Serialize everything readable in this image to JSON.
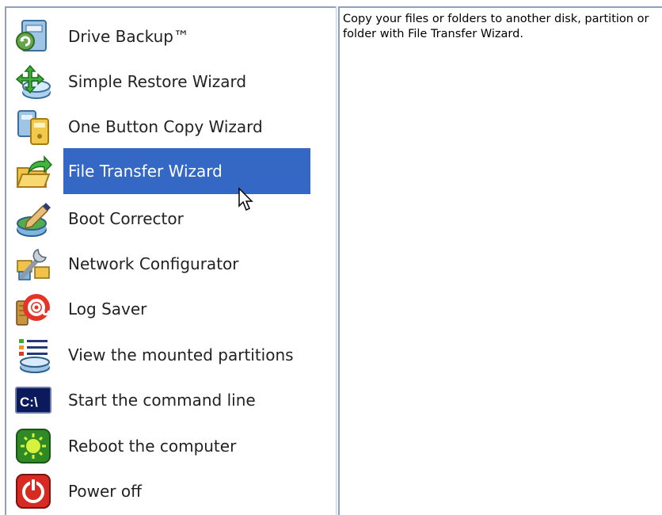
{
  "menu": {
    "items": [
      {
        "label": "Drive Backup™",
        "icon": "drive-backup-icon"
      },
      {
        "label": "Simple Restore Wizard",
        "icon": "restore-icon"
      },
      {
        "label": "One Button Copy Wizard",
        "icon": "copy-disk-icon"
      },
      {
        "label": "File Transfer Wizard",
        "icon": "folder-transfer-icon",
        "selected": true
      },
      {
        "label": "Boot Corrector",
        "icon": "boot-corrector-icon"
      },
      {
        "label": "Network Configurator",
        "icon": "network-config-icon"
      },
      {
        "label": "Log Saver",
        "icon": "log-saver-icon"
      },
      {
        "label": "View the mounted partitions",
        "icon": "partitions-list-icon"
      },
      {
        "label": "Start the command line",
        "icon": "command-line-icon"
      },
      {
        "label": "Reboot the computer",
        "icon": "reboot-icon"
      },
      {
        "label": "Power off",
        "icon": "power-off-icon"
      }
    ]
  },
  "description": "Copy your files or folders to another disk, partition or folder with File Transfer Wizard.",
  "colors": {
    "selection": "#3567c4",
    "pane_border": "#8fa0b8"
  }
}
